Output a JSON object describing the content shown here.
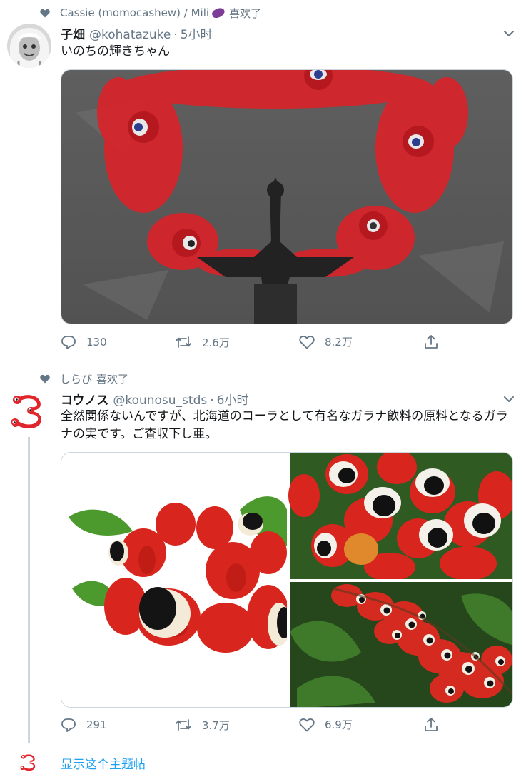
{
  "tweets": [
    {
      "social_context": {
        "liked_by": "Cassie (momocashew) / Mili",
        "emoji_icon": "eggplant-emoji",
        "action_label": "喜欢了"
      },
      "author": {
        "display_name": "子畑",
        "handle": "@kohatazuke",
        "separator": "·",
        "time": "5小时"
      },
      "text": "いのちの輝きちゃん",
      "stats": {
        "replies": "130",
        "retweets": "2.6万",
        "likes": "8.2万"
      }
    },
    {
      "social_context": {
        "liked_by": "しらび",
        "action_label": "喜欢了"
      },
      "author": {
        "display_name": "コウノス",
        "handle": "@kounosu_stds",
        "separator": "·",
        "time": "6小时"
      },
      "text": "全然関係ないんですが、北海道のコーラとして有名なガラナ飲料の原料となるガラナの実です。ご査収下し亜。",
      "stats": {
        "replies": "291",
        "retweets": "3.7万",
        "likes": "6.9万"
      }
    }
  ],
  "thread": {
    "show_thread_label": "显示这个主题帖"
  },
  "colors": {
    "text_primary": "#14171a",
    "text_secondary": "#657786",
    "link_blue": "#1da1f2",
    "border": "#e6ecf0",
    "logo_red": "#e0262c"
  }
}
